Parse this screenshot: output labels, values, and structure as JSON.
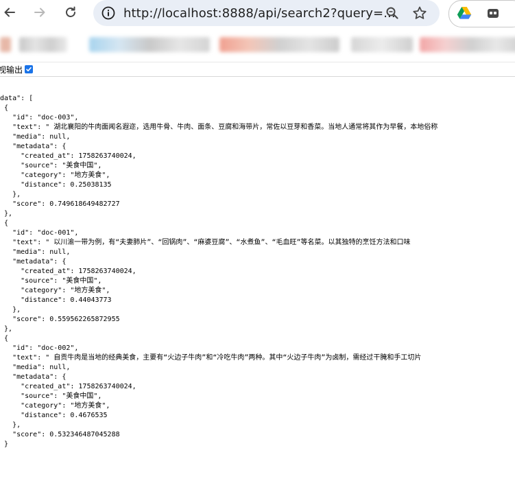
{
  "browser": {
    "url": "http://localhost:8888/api/search2?query=...",
    "icons": {
      "back": "back-arrow-icon",
      "forward": "forward-arrow-icon",
      "reload": "reload-icon",
      "site_info": "site-info-icon",
      "zoom": "zoom-icon",
      "bookmark": "star-icon",
      "drive": "google-drive-icon",
      "extension": "extension-icon"
    }
  },
  "viewer": {
    "pretty_print_label": "视输出",
    "pretty_print_checked": true
  },
  "json_lines": [
    "\"data\": [",
    "  {",
    "    \"id\": \"doc-003\",",
    "    \"text\": \" 湖北襄阳的牛肉面闻名遐迩，选用牛骨、牛肉、面条、豆腐和海带片，常佐以豆芽和香菜。当地人通常将其作为早餐，本地俗称",
    "    \"media\": null,",
    "    \"metadata\": {",
    "      \"created_at\": 1758263740024,",
    "      \"source\": \"美食中国\",",
    "      \"category\": \"地方美食\",",
    "      \"distance\": 0.25038135",
    "    },",
    "    \"score\": 0.749618649482727",
    "  },",
    "  {",
    "    \"id\": \"doc-001\",",
    "    \"text\": \" 以川渝一带为例，有“夫妻肺片”、“回锅肉”、“麻婆豆腐”、“水煮鱼”、“毛血旺”等名菜。以其独特的烹饪方法和口味",
    "    \"media\": null,",
    "    \"metadata\": {",
    "      \"created_at\": 1758263740024,",
    "      \"source\": \"美食中国\",",
    "      \"category\": \"地方美食\",",
    "      \"distance\": 0.44043773",
    "    },",
    "    \"score\": 0.559562265872955",
    "  },",
    "  {",
    "    \"id\": \"doc-002\",",
    "    \"text\": \" 自贡牛肉是当地的经典美食，主要有“火边子牛肉”和“冷吃牛肉”两种。其中“火边子牛肉”为卤制，需经过干腌和手工切片",
    "    \"media\": null,",
    "    \"metadata\": {",
    "      \"created_at\": 1758263740024,",
    "      \"source\": \"美食中国\",",
    "      \"category\": \"地方美食\",",
    "      \"distance\": 0.4676535",
    "    },",
    "    \"score\": 0.532346487045288",
    "  }",
    "]"
  ],
  "colors": {
    "omnibox_bg": "#e9eef6",
    "checkbox": "#1a73e8",
    "icon": "#474747"
  }
}
